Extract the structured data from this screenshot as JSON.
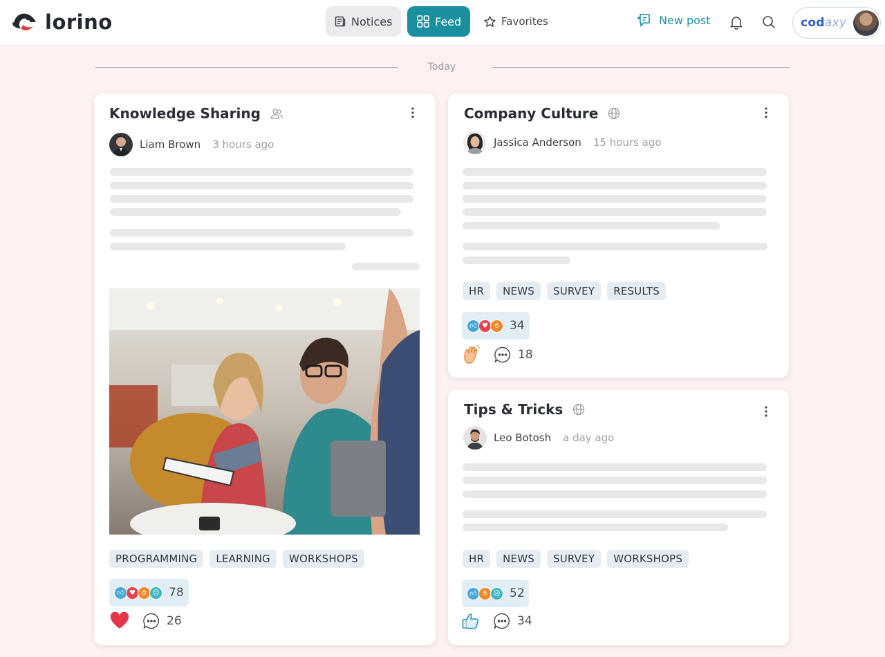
{
  "app": {
    "name": "lorino",
    "brand_color": "#1a8fa0"
  },
  "header": {
    "nav": [
      {
        "id": "notices",
        "label": "Notices",
        "icon": "newspaper-icon",
        "active": false
      },
      {
        "id": "feed",
        "label": "Feed",
        "icon": "grid-icon",
        "active": true
      },
      {
        "id": "favorites",
        "label": "Favorites",
        "icon": "star-icon",
        "active": false
      }
    ],
    "new_post_label": "New post",
    "account_brand_a": "cod",
    "account_brand_b": "axy"
  },
  "feed": {
    "day_label": "Today",
    "posts": [
      {
        "title": "Knowledge Sharing",
        "visibility_icon": "users-icon",
        "author": "Liam Brown",
        "time": "3 hours ago",
        "has_image": true,
        "tags": [
          "PROGRAMMING",
          "LEARNING",
          "WORKSHOPS"
        ],
        "reaction_icons": [
          "like",
          "love",
          "clap",
          "sad"
        ],
        "reaction_count": "78",
        "my_reaction_icon": "heart-icon",
        "comment_count": "26"
      },
      {
        "title": "Company Culture",
        "visibility_icon": "globe-icon",
        "author": "Jassica Anderson",
        "time": "15 hours ago",
        "has_image": false,
        "tags": [
          "HR",
          "NEWS",
          "SURVEY",
          "RESULTS"
        ],
        "reaction_icons": [
          "like",
          "love",
          "clap"
        ],
        "reaction_count": "34",
        "my_reaction_icon": "clap-icon",
        "comment_count": "18"
      },
      {
        "title": "Tips & Tricks",
        "visibility_icon": "globe-icon",
        "author": "Leo Botosh",
        "time": "a day ago",
        "has_image": false,
        "tags": [
          "HR",
          "NEWS",
          "SURVEY",
          "WORKSHOPS"
        ],
        "reaction_icons": [
          "like",
          "clap",
          "sad"
        ],
        "reaction_count": "52",
        "my_reaction_icon": "thumbs-up-icon",
        "comment_count": "34"
      }
    ]
  }
}
